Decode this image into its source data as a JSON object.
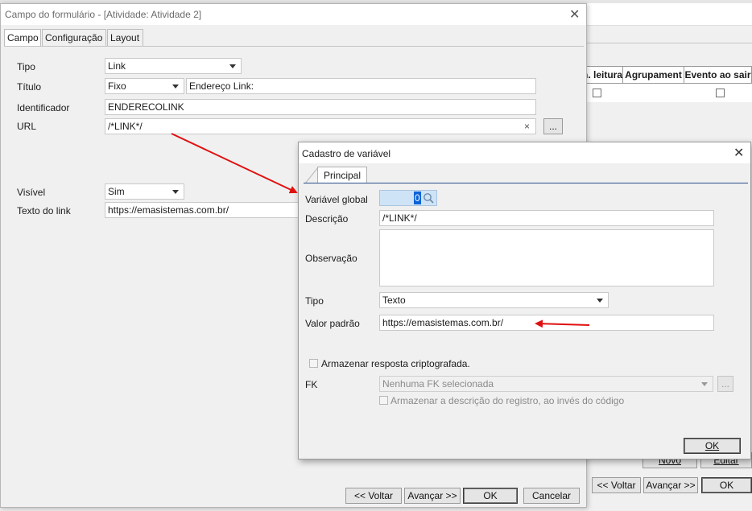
{
  "bg_window": {
    "columns": [
      "n. leitura",
      "Agrupament",
      "Evento ao sair"
    ],
    "buttons": {
      "novo": "Novo",
      "editar": "Editar",
      "voltar": "<< Voltar",
      "avancar": "Avançar >>",
      "ok": "OK"
    }
  },
  "main_dialog": {
    "title": "Campo do formulário - [Atividade: Atividade 2]",
    "tabs": [
      "Campo",
      "Configuração",
      "Layout"
    ],
    "fields": {
      "tipo_label": "Tipo",
      "tipo_value": "Link",
      "titulo_label": "Título",
      "titulo_mode": "Fixo",
      "titulo_value": "Endereço Link:",
      "identificador_label": "Identificador",
      "identificador_value": "ENDERECOLINK",
      "url_label": "URL",
      "url_value": "/*LINK*/",
      "url_clear": "×",
      "url_browse": "...",
      "visivel_label": "Visível",
      "visivel_value": "Sim",
      "texto_link_label": "Texto do link",
      "texto_link_value": "https://emasistemas.com.br/"
    },
    "buttons": {
      "voltar": "<< Voltar",
      "avancar": "Avançar >>",
      "ok": "OK",
      "cancelar": "Cancelar"
    }
  },
  "var_dialog": {
    "title": "Cadastro de variável",
    "tab": "Principal",
    "variavel_global_label": "Variável global",
    "variavel_global_value": "0",
    "descricao_label": "Descrição",
    "descricao_value": "/*LINK*/",
    "observacao_label": "Observação",
    "observacao_value": "",
    "tipo_label": "Tipo",
    "tipo_value": "Texto",
    "valor_padrao_label": "Valor padrão",
    "valor_padrao_value": "https://emasistemas.com.br/",
    "armazenar_cripto_label": "Armazenar resposta criptografada.",
    "fk_label": "FK",
    "fk_value": "Nenhuma FK selecionada",
    "fk_browse": "...",
    "armazenar_descricao_label": "Armazenar a descrição do registro, ao invés do código",
    "ok": "OK"
  },
  "colors": {
    "annotation_arrow": "#e01010",
    "selection": "#0a64d8"
  }
}
